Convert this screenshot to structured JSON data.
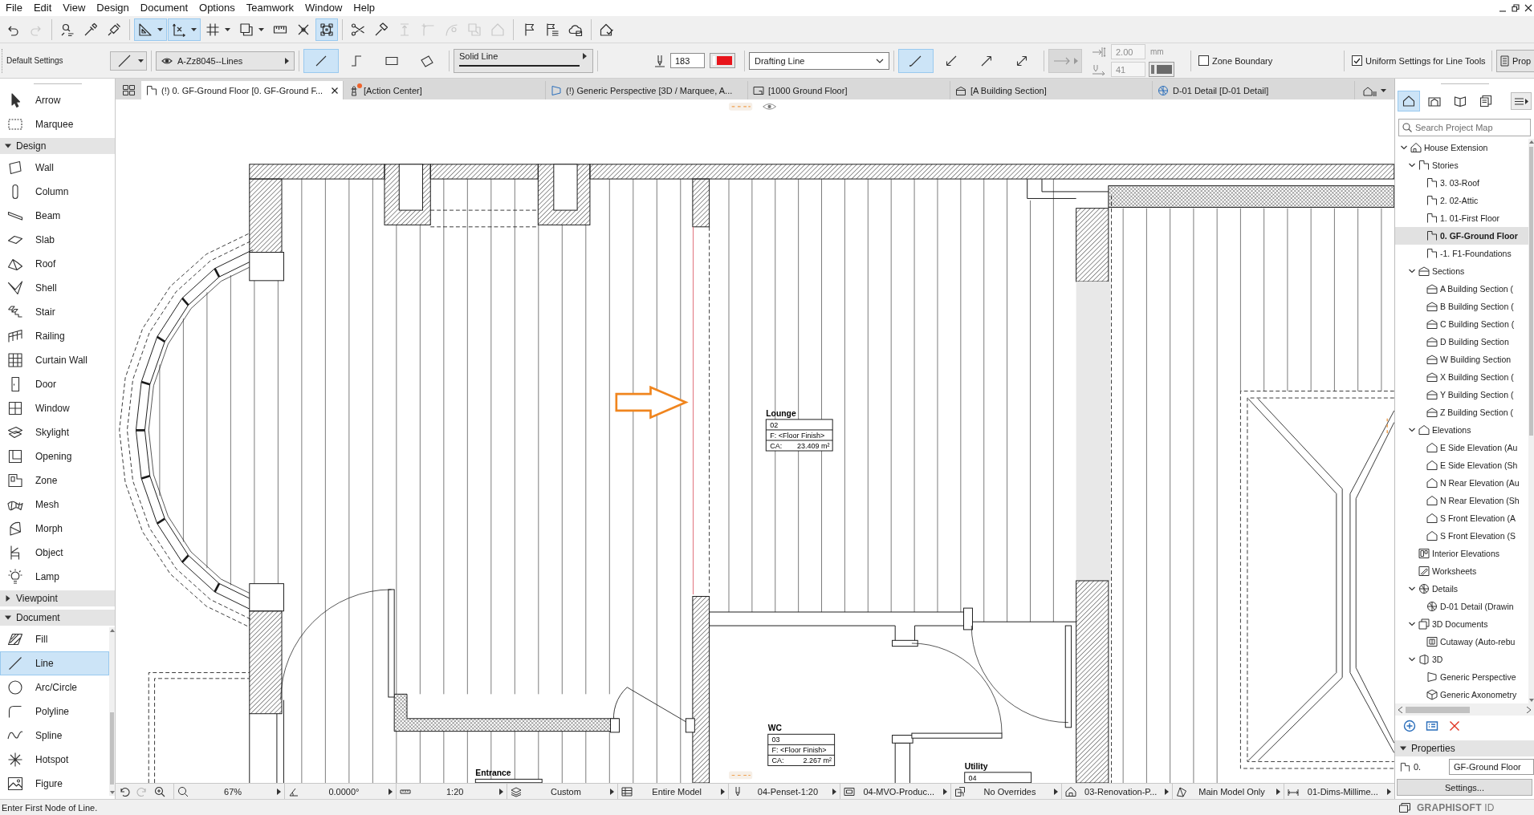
{
  "menu_bar": {
    "items": [
      "File",
      "Edit",
      "View",
      "Design",
      "Document",
      "Options",
      "Teamwork",
      "Window",
      "Help"
    ]
  },
  "window_controls": [
    {
      "kind": "minimize"
    },
    {
      "kind": "restore"
    },
    {
      "kind": "close"
    }
  ],
  "standard_toolbar": {
    "groups": [
      [
        {
          "kind": "undo",
          "selected": false,
          "disabled": false
        },
        {
          "kind": "redo",
          "selected": false,
          "disabled": true
        }
      ],
      [
        {
          "kind": "find",
          "selected": false,
          "disabled": false
        },
        {
          "kind": "pick",
          "selected": false,
          "disabled": false
        },
        {
          "kind": "inject",
          "selected": false,
          "disabled": false
        }
      ],
      [
        {
          "kind": "guides",
          "selected": true,
          "disabled": false,
          "menu": true
        },
        {
          "kind": "coordinates",
          "selected": true,
          "disabled": false,
          "menu": true
        },
        {
          "kind": "grid",
          "selected": false,
          "disabled": false,
          "menu": true
        },
        {
          "kind": "layers",
          "selected": false,
          "disabled": false,
          "menu": true
        },
        {
          "kind": "measure",
          "selected": false,
          "disabled": false
        },
        {
          "kind": "snap",
          "selected": false,
          "disabled": false
        },
        {
          "kind": "points",
          "selected": true,
          "disabled": false
        }
      ],
      [
        {
          "kind": "split",
          "selected": false,
          "disabled": false
        },
        {
          "kind": "adjust",
          "selected": false,
          "disabled": false
        },
        {
          "kind": "elevate",
          "selected": false,
          "disabled": true
        },
        {
          "kind": "fillet",
          "selected": false,
          "disabled": true
        },
        {
          "kind": "curve",
          "selected": false,
          "disabled": true
        },
        {
          "kind": "offset",
          "selected": false,
          "disabled": true
        },
        {
          "kind": "roof",
          "selected": false,
          "disabled": true
        }
      ],
      [
        {
          "kind": "flag",
          "selected": false,
          "disabled": false
        },
        {
          "kind": "issues",
          "selected": false,
          "disabled": false
        },
        {
          "kind": "cloud",
          "selected": false,
          "disabled": false
        }
      ],
      [
        {
          "kind": "check",
          "selected": false,
          "disabled": false
        }
      ]
    ]
  },
  "info_box": {
    "title": "Default Settings",
    "layer": "A-Zz8045--Lines",
    "geometry_methods": [
      {
        "kind": "single",
        "selected": true
      },
      {
        "kind": "chained",
        "selected": false
      },
      {
        "kind": "rectangle",
        "selected": false
      },
      {
        "kind": "rotated",
        "selected": false
      }
    ],
    "line_type": "Solid Line",
    "pen": "183",
    "category": "Drafting Line",
    "arrowheads": [
      {
        "kind": "none",
        "selected": true
      },
      {
        "kind": "start",
        "selected": false
      },
      {
        "kind": "end",
        "selected": false
      },
      {
        "kind": "both",
        "selected": false
      }
    ],
    "arrow_settings": {
      "disabled": true,
      "size": "2.00",
      "unit": "mm",
      "pen": "41"
    },
    "zone_boundary": {
      "label": "Zone Boundary",
      "checked": false
    },
    "uniform_settings": {
      "label": "Uniform Settings for Line Tools",
      "checked": true
    },
    "properties_button": "Prop"
  },
  "toolbox": {
    "tools": [
      {
        "kind": "arrow",
        "label": "Arrow",
        "selected": false
      },
      {
        "kind": "marquee",
        "label": "Marquee",
        "selected": false
      }
    ],
    "sections": [
      {
        "label": "Design",
        "expanded": true,
        "tools": [
          {
            "kind": "wall",
            "label": "Wall",
            "selected": false
          },
          {
            "kind": "column",
            "label": "Column",
            "selected": false
          },
          {
            "kind": "beam",
            "label": "Beam",
            "selected": false
          },
          {
            "kind": "slab",
            "label": "Slab",
            "selected": false
          },
          {
            "kind": "roof",
            "label": "Roof",
            "selected": false
          },
          {
            "kind": "shell",
            "label": "Shell",
            "selected": false
          },
          {
            "kind": "stair",
            "label": "Stair",
            "selected": false
          },
          {
            "kind": "railing",
            "label": "Railing",
            "selected": false
          },
          {
            "kind": "curtainwall",
            "label": "Curtain Wall",
            "selected": false
          },
          {
            "kind": "door",
            "label": "Door",
            "selected": false
          },
          {
            "kind": "window",
            "label": "Window",
            "selected": false
          },
          {
            "kind": "skylight",
            "label": "Skylight",
            "selected": false
          },
          {
            "kind": "opening",
            "label": "Opening",
            "selected": false
          },
          {
            "kind": "zone",
            "label": "Zone",
            "selected": false
          },
          {
            "kind": "mesh",
            "label": "Mesh",
            "selected": false
          },
          {
            "kind": "morph",
            "label": "Morph",
            "selected": false
          },
          {
            "kind": "object",
            "label": "Object",
            "selected": false
          },
          {
            "kind": "lamp",
            "label": "Lamp",
            "selected": false
          }
        ]
      },
      {
        "label": "Viewpoint",
        "expanded": false
      },
      {
        "label": "Document",
        "expanded": true,
        "tools": [
          {
            "kind": "fill",
            "label": "Fill",
            "selected": false
          },
          {
            "kind": "line",
            "label": "Line",
            "selected": true
          },
          {
            "kind": "arc",
            "label": "Arc/Circle",
            "selected": false
          },
          {
            "kind": "polyline",
            "label": "Polyline",
            "selected": false
          },
          {
            "kind": "spline",
            "label": "Spline",
            "selected": false
          },
          {
            "kind": "hotspot",
            "label": "Hotspot",
            "selected": false
          },
          {
            "kind": "figure",
            "label": "Figure",
            "selected": false
          }
        ]
      }
    ]
  },
  "view_tabs": {
    "tabs": [
      {
        "kind": "floor",
        "title": "(!) 0. GF-Ground Floor [0. GF-Ground F...",
        "selected": true,
        "alert": false
      },
      {
        "kind": "action",
        "title": "[Action Center]",
        "selected": false,
        "alert": true
      },
      {
        "kind": "perspective",
        "title": "(!) Generic Perspective [3D / Marquee, A...",
        "selected": false,
        "alert": false
      },
      {
        "kind": "layout",
        "title": "[1000 Ground Floor]",
        "selected": false,
        "alert": false
      },
      {
        "kind": "section",
        "title": "[A Building Section]",
        "selected": false,
        "alert": false
      },
      {
        "kind": "detail",
        "title": "D-01 Detail [D-01 Detail]",
        "selected": false,
        "alert": false
      }
    ]
  },
  "canvas": {
    "zones": [
      {
        "name": "Lounge",
        "number": "02",
        "finish": "F: <Floor Finish>",
        "area_label": "CA:",
        "area": "23.409 m²"
      },
      {
        "name": "WC",
        "number": "03",
        "finish": "F: <Floor Finish>",
        "area_label": "CA:",
        "area": "2.267 m²"
      },
      {
        "name": "Entrance"
      },
      {
        "name": "Utility",
        "number": "04"
      }
    ]
  },
  "quick_options": {
    "navigation": [
      {
        "kind": "back",
        "disabled": false
      },
      {
        "kind": "forward",
        "disabled": true
      },
      {
        "kind": "zoomin",
        "disabled": false
      }
    ],
    "popups": [
      {
        "kind": "zoom",
        "value": "67%"
      },
      {
        "kind": "angle",
        "value": "0.0000°"
      },
      {
        "kind": "scale",
        "value": "1:20"
      },
      {
        "kind": "layers",
        "value": "Custom"
      },
      {
        "kind": "modelview",
        "value": "Entire Model"
      },
      {
        "kind": "penset",
        "value": "04-Penset-1:20"
      },
      {
        "kind": "mvo",
        "value": "04-MVO-Produc..."
      },
      {
        "kind": "overrides",
        "value": "No Overrides"
      },
      {
        "kind": "renovation",
        "value": "03-Renovation-P..."
      },
      {
        "kind": "structure",
        "value": "Main Model Only"
      },
      {
        "kind": "dimensions",
        "value": "01-Dims-Millime..."
      }
    ]
  },
  "navigator": {
    "modes": [
      {
        "kind": "project",
        "selected": true
      },
      {
        "kind": "views",
        "selected": false
      },
      {
        "kind": "layouts",
        "selected": false
      },
      {
        "kind": "publisher",
        "selected": false
      }
    ],
    "search": {
      "placeholder": "Search Project Map"
    },
    "tree": [
      {
        "label": "House Extension",
        "kind": "project",
        "selected": false,
        "expanded": true,
        "children": [
          {
            "label": "Stories",
            "kind": "story",
            "selected": false,
            "expanded": true,
            "children": [
              {
                "label": "3. 03-Roof",
                "kind": "story",
                "selected": false
              },
              {
                "label": "2. 02-Attic",
                "kind": "story",
                "selected": false
              },
              {
                "label": "1. 01-First Floor",
                "kind": "story",
                "selected": false
              },
              {
                "label": "0. GF-Ground Floor",
                "kind": "story",
                "selected": true
              },
              {
                "label": "-1. F1-Foundations",
                "kind": "story",
                "selected": false
              }
            ]
          },
          {
            "label": "Sections",
            "kind": "section",
            "selected": false,
            "expanded": true,
            "children": [
              {
                "label": "A Building Section (",
                "kind": "section",
                "selected": false
              },
              {
                "label": "B Building Section (",
                "kind": "section",
                "selected": false
              },
              {
                "label": "C Building Section (",
                "kind": "section",
                "selected": false
              },
              {
                "label": "D Building Section",
                "kind": "section",
                "selected": false
              },
              {
                "label": "W Building Section",
                "kind": "section",
                "selected": false
              },
              {
                "label": "X Building Section (",
                "kind": "section",
                "selected": false
              },
              {
                "label": "Y Building Section (",
                "kind": "section",
                "selected": false
              },
              {
                "label": "Z Building Section (",
                "kind": "section",
                "selected": false
              }
            ]
          },
          {
            "label": "Elevations",
            "kind": "elevation",
            "selected": false,
            "expanded": true,
            "children": [
              {
                "label": "E Side Elevation (Au",
                "kind": "elevation",
                "selected": false
              },
              {
                "label": "E Side Elevation (Sh",
                "kind": "elevation",
                "selected": false
              },
              {
                "label": "N Rear Elevation (Au",
                "kind": "elevation",
                "selected": false
              },
              {
                "label": "N Rear Elevation (Sh",
                "kind": "elevation",
                "selected": false
              },
              {
                "label": "S Front Elevation (A",
                "kind": "elevation",
                "selected": false
              },
              {
                "label": "S Front Elevation (S",
                "kind": "elevation",
                "selected": false
              }
            ]
          },
          {
            "label": "Interior Elevations",
            "kind": "interior",
            "selected": false
          },
          {
            "label": "Worksheets",
            "kind": "worksheet",
            "selected": false
          },
          {
            "label": "Details",
            "kind": "detail",
            "selected": false,
            "expanded": true,
            "children": [
              {
                "label": "D-01 Detail (Drawin",
                "kind": "detail",
                "selected": false
              }
            ]
          },
          {
            "label": "3D Documents",
            "kind": "document",
            "selected": false,
            "expanded": true,
            "children": [
              {
                "label": "Cutaway (Auto-rebu",
                "kind": "cutaway",
                "selected": false
              }
            ]
          },
          {
            "label": "3D",
            "kind": "model",
            "selected": false,
            "expanded": true,
            "children": [
              {
                "label": "Generic Perspective",
                "kind": "perspective",
                "selected": false
              },
              {
                "label": "Generic Axonometry",
                "kind": "axonometry",
                "selected": false
              }
            ]
          }
        ]
      }
    ],
    "actions": [
      {
        "kind": "add"
      },
      {
        "kind": "settings"
      },
      {
        "kind": "delete"
      }
    ],
    "properties": {
      "title": "Properties",
      "expanded": true,
      "number": "0.",
      "name": "GF-Ground Floor",
      "settings_button": "Settings..."
    }
  },
  "status_bar": {
    "message": "Enter First Node of Line.",
    "account": "**GRAPHISOFT** ID"
  }
}
